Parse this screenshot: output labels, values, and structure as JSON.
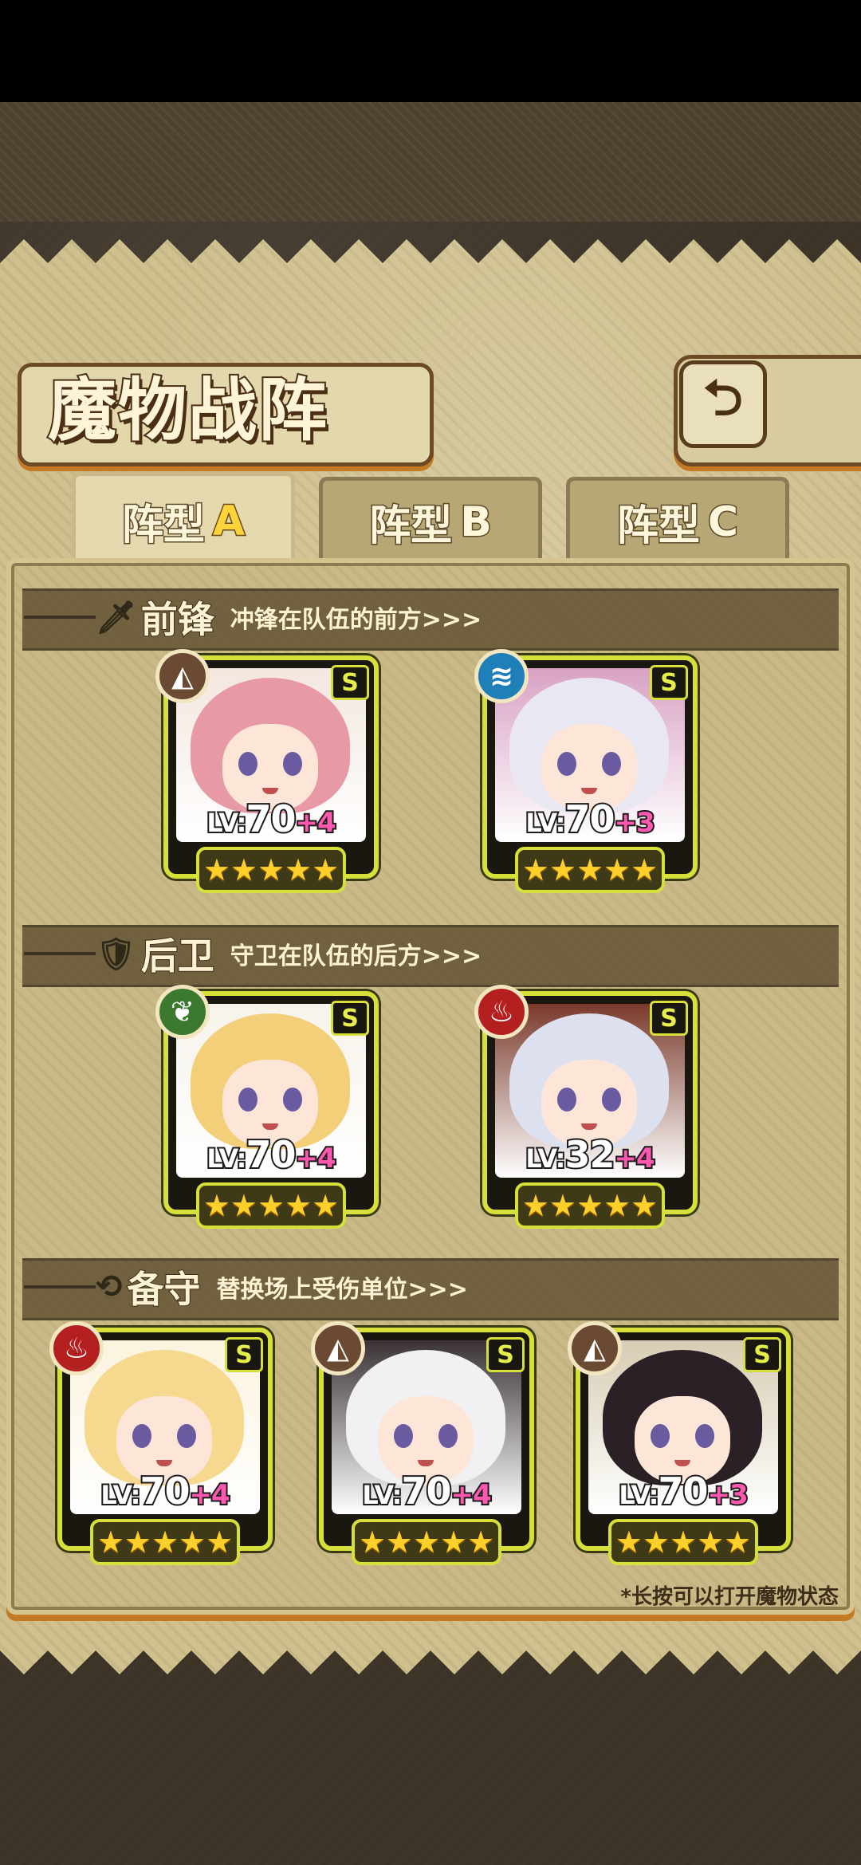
{
  "title": "魔物战阵",
  "back_icon": "return-arrow-icon",
  "tabs": [
    {
      "name": "阵型",
      "letter": "A",
      "active": true
    },
    {
      "name": "阵型",
      "letter": "B",
      "active": false
    },
    {
      "name": "阵型",
      "letter": "C",
      "active": false
    }
  ],
  "sections": [
    {
      "icon": "sword-icon",
      "name": "前锋",
      "desc": "冲锋在队伍的前方>>>"
    },
    {
      "icon": "shield-icon",
      "name": "后卫",
      "desc": "守卫在队伍的后方>>>"
    },
    {
      "icon": "swap-icon",
      "name": "备守",
      "desc": "替换场上受伤单位>>>"
    }
  ],
  "cards": [
    {
      "element": "earth",
      "element_color": "#6a4a32",
      "rank": "S",
      "lv_prefix": "LV:",
      "lv": "70",
      "plus": "+4",
      "stars": "★★★★★",
      "hair_color": "#e79aa6",
      "bg_color": "#f3e7df"
    },
    {
      "element": "water",
      "element_color": "#1f7fb8",
      "rank": "S",
      "lv_prefix": "LV:",
      "lv": "70",
      "plus": "+3",
      "stars": "★★★★★",
      "hair_color": "#e9e8f2",
      "bg_color": "#d9a2c4"
    },
    {
      "element": "wind",
      "element_color": "#3b7a2e",
      "rank": "S",
      "lv_prefix": "LV:",
      "lv": "70",
      "plus": "+4",
      "stars": "★★★★★",
      "hair_color": "#f3cf7a",
      "bg_color": "#f6f3ea"
    },
    {
      "element": "fire",
      "element_color": "#b42020",
      "rank": "S",
      "lv_prefix": "LV:",
      "lv": "32",
      "plus": "+4",
      "stars": "★★★★★",
      "hair_color": "#dde0ee",
      "bg_color": "#7a3a2c"
    },
    {
      "element": "fire",
      "element_color": "#b42020",
      "rank": "S",
      "lv_prefix": "LV:",
      "lv": "70",
      "plus": "+4",
      "stars": "★★★★★",
      "hair_color": "#f6d98e",
      "bg_color": "#fbf3de"
    },
    {
      "element": "earth",
      "element_color": "#6a4a32",
      "rank": "S",
      "lv_prefix": "LV:",
      "lv": "70",
      "plus": "+4",
      "stars": "★★★★★",
      "hair_color": "#f1f1f4",
      "bg_color": "#3a3236"
    },
    {
      "element": "earth",
      "element_color": "#6a4a32",
      "rank": "S",
      "lv_prefix": "LV:",
      "lv": "70",
      "plus": "+3",
      "stars": "★★★★★",
      "hair_color": "#2a2026",
      "bg_color": "#d7cdb4"
    }
  ],
  "footnote": "*长按可以打开魔物状态"
}
